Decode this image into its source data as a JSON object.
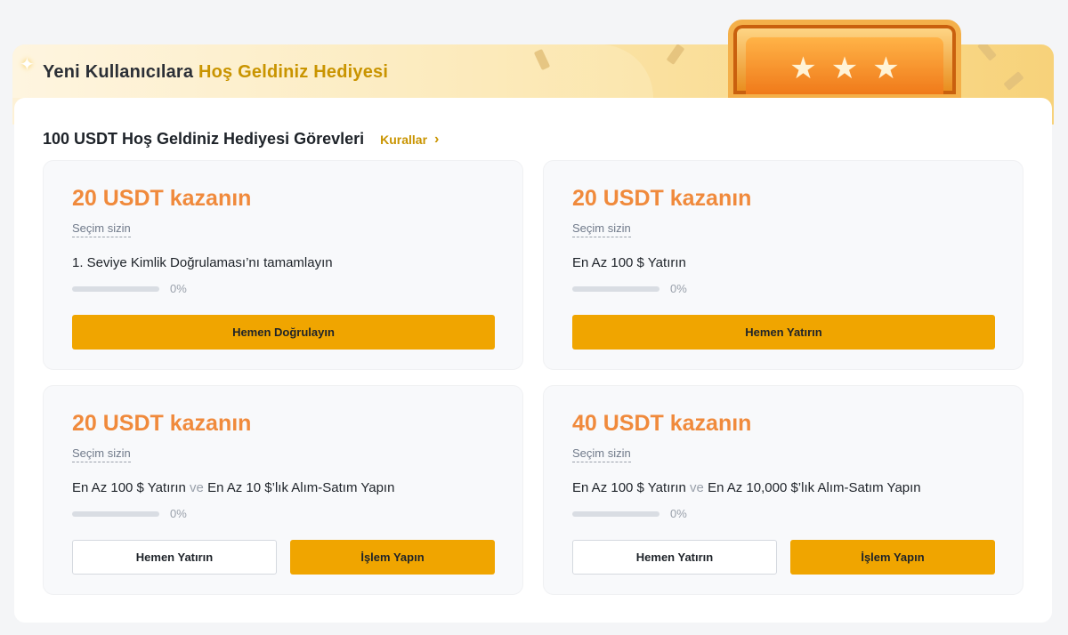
{
  "header": {
    "title_part1": "Yeni Kullanıcılara ",
    "title_part2": "Hoş Geldiniz Hediyesi",
    "sparkle_icon": "sparkle-icon",
    "stars": [
      "★",
      "★",
      "★"
    ]
  },
  "section": {
    "title": "100 USDT Hoş Geldiniz Hediyesi Görevleri",
    "rules_label": "Kurallar",
    "rules_icon": "chevron-right-icon"
  },
  "tasks": [
    {
      "title": "20 USDT kazanın",
      "choice": "Seçim sizin",
      "desc_a": "1. Seviye Kimlik Doğrulaması’nı tamamlayın",
      "connector": "",
      "desc_b": "",
      "progress": 0,
      "progress_label": "0%",
      "primary_label": "Hemen Doğrulayın",
      "secondary_label": ""
    },
    {
      "title": "20 USDT kazanın",
      "choice": "Seçim sizin",
      "desc_a": "En Az 100 $ Yatırın",
      "connector": "",
      "desc_b": "",
      "progress": 0,
      "progress_label": "0%",
      "primary_label": "Hemen Yatırın",
      "secondary_label": ""
    },
    {
      "title": "20 USDT kazanın",
      "choice": "Seçim sizin",
      "desc_a": "En Az 100 $ Yatırın",
      "connector": " ve ",
      "desc_b": "En Az 10 $’lık Alım-Satım Yapın",
      "progress": 0,
      "progress_label": "0%",
      "secondary_label": "Hemen Yatırın",
      "primary_label": "İşlem Yapın"
    },
    {
      "title": "40 USDT kazanın",
      "choice": "Seçim sizin",
      "desc_a": "En Az 100 $ Yatırın",
      "connector": " ve ",
      "desc_b": "En Az 10,000 $’lık Alım-Satım Yapın",
      "progress": 0,
      "progress_label": "0%",
      "secondary_label": "Hemen Yatırın",
      "primary_label": "İşlem Yapın"
    }
  ],
  "colors": {
    "accent": "#f0a500",
    "reward": "#f08a3c",
    "gold": "#c99400"
  }
}
